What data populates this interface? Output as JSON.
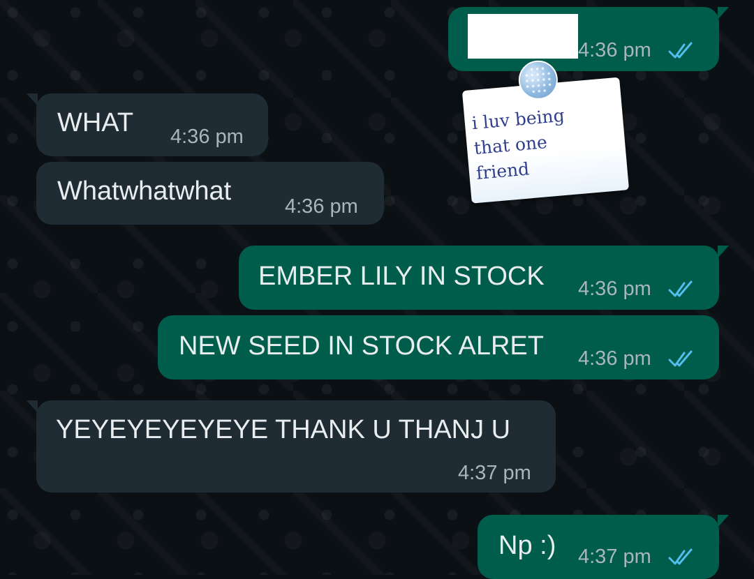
{
  "colors": {
    "background": "#0b1014",
    "incoming_bubble": "#202c33",
    "outgoing_bubble": "#005c4b",
    "text": "#e9edef",
    "timestamp": "#a8b7bd",
    "read_ticks": "#53bdeb"
  },
  "icons": {
    "read_receipt": "double-check-icon"
  },
  "messages": [
    {
      "direction": "outgoing",
      "text": "",
      "time": "4:36 pm",
      "status": "read",
      "redacted": true
    },
    {
      "direction": "incoming",
      "text": "WHAT",
      "time": "4:36 pm"
    },
    {
      "direction": "incoming",
      "text": "Whatwhatwhat",
      "time": "4:36 pm"
    },
    {
      "direction": "outgoing",
      "text": "EMBER LILY IN STOCK",
      "time": "4:36 pm",
      "status": "read"
    },
    {
      "direction": "outgoing",
      "text": "NEW SEED IN STOCK ALRET",
      "time": "4:36 pm",
      "status": "read"
    },
    {
      "direction": "incoming",
      "text": "YEYEYEYEYEYE THANK U THANJ U",
      "time": "4:37 pm"
    },
    {
      "direction": "outgoing",
      "text": "Np :)",
      "time": "4:37 pm",
      "status": "read"
    }
  ],
  "sticker": {
    "text": "i luv being\nthat one\nfriend"
  }
}
